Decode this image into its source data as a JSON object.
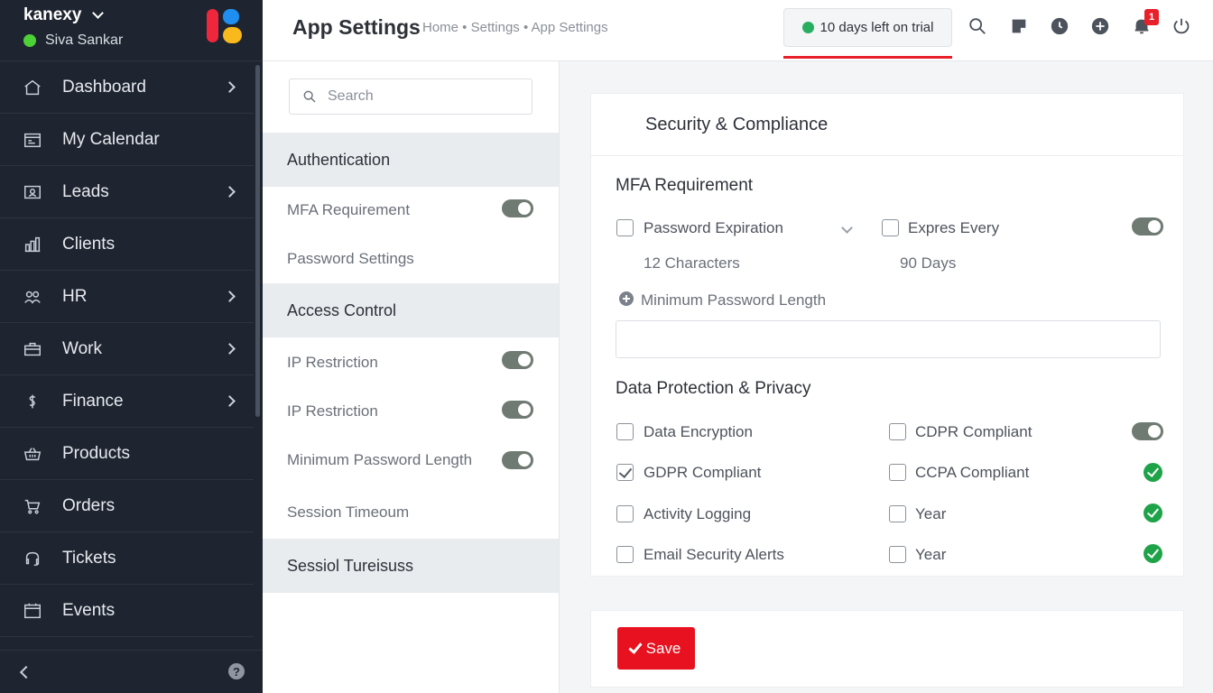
{
  "sidebar": {
    "brand": "kanexy",
    "user_name": "Siva Sankar",
    "items": [
      {
        "label": "Dashboard",
        "icon": "home-icon",
        "has_arrow": true
      },
      {
        "label": "My Calendar",
        "icon": "calendar-icon",
        "has_arrow": false
      },
      {
        "label": "Leads",
        "icon": "id-card-icon",
        "has_arrow": true
      },
      {
        "label": "Clients",
        "icon": "building-icon",
        "has_arrow": false
      },
      {
        "label": "HR",
        "icon": "users-icon",
        "has_arrow": true
      },
      {
        "label": "Work",
        "icon": "briefcase-icon",
        "has_arrow": true
      },
      {
        "label": "Finance",
        "icon": "dollar-icon",
        "has_arrow": true
      },
      {
        "label": "Products",
        "icon": "basket-icon",
        "has_arrow": false
      },
      {
        "label": "Orders",
        "icon": "cart-icon",
        "has_arrow": false
      },
      {
        "label": "Tickets",
        "icon": "headset-icon",
        "has_arrow": false
      },
      {
        "label": "Events",
        "icon": "event-icon",
        "has_arrow": false
      }
    ],
    "help_glyph": "?"
  },
  "topbar": {
    "title": "App Settings",
    "breadcrumb": "Home • Settings • App Settings",
    "trial_text": "10 days left on trial",
    "notification_count": "1"
  },
  "subnav": {
    "search_placeholder": "Search",
    "sections": [
      {
        "label": "Authentication"
      },
      {
        "label": "Access Control"
      },
      {
        "label": "Sessiol Tureisuss"
      }
    ],
    "items": [
      {
        "label": "MFA Requirement",
        "toggle": true
      },
      {
        "label": "Password Settings",
        "toggle": false
      },
      {
        "label": "IP Restriction",
        "toggle": true
      },
      {
        "label": "IP Restriction",
        "toggle": true
      },
      {
        "label": "Minimum Password Length",
        "toggle": true
      },
      {
        "label": "Session Timeoum",
        "toggle": false
      }
    ]
  },
  "card": {
    "title": "Security & Compliance",
    "mfa": {
      "heading": "MFA Requirement",
      "password_expiration": "Password Expiration",
      "expires_every": "Expres Every",
      "length_value": "12 Characters",
      "days_value": "90 Days",
      "min_length_label": "Minimum Password Length",
      "min_length_value": ""
    },
    "privacy": {
      "heading": "Data Protection & Privacy",
      "rows": [
        {
          "left": "Data Encryption",
          "left_checked": false,
          "right": "CDPR Compliant",
          "right_checked": false,
          "status": "toggle"
        },
        {
          "left": "GDPR Compliant",
          "left_checked": true,
          "right": "CCPA Compliant",
          "right_checked": false,
          "status": "ok"
        },
        {
          "left": "Activity Logging",
          "left_checked": false,
          "right": "Year",
          "right_checked": false,
          "status": "ok"
        },
        {
          "left": "Email Security Alerts",
          "left_checked": false,
          "right": "Year",
          "right_checked": false,
          "status": "ok"
        }
      ]
    }
  },
  "actions": {
    "save_label": "Save"
  },
  "colors": {
    "sidebar_bg": "#1f2530",
    "accent_red": "#e8111f",
    "status_green": "#1fa349",
    "toggle_on": "#6f7a72"
  }
}
